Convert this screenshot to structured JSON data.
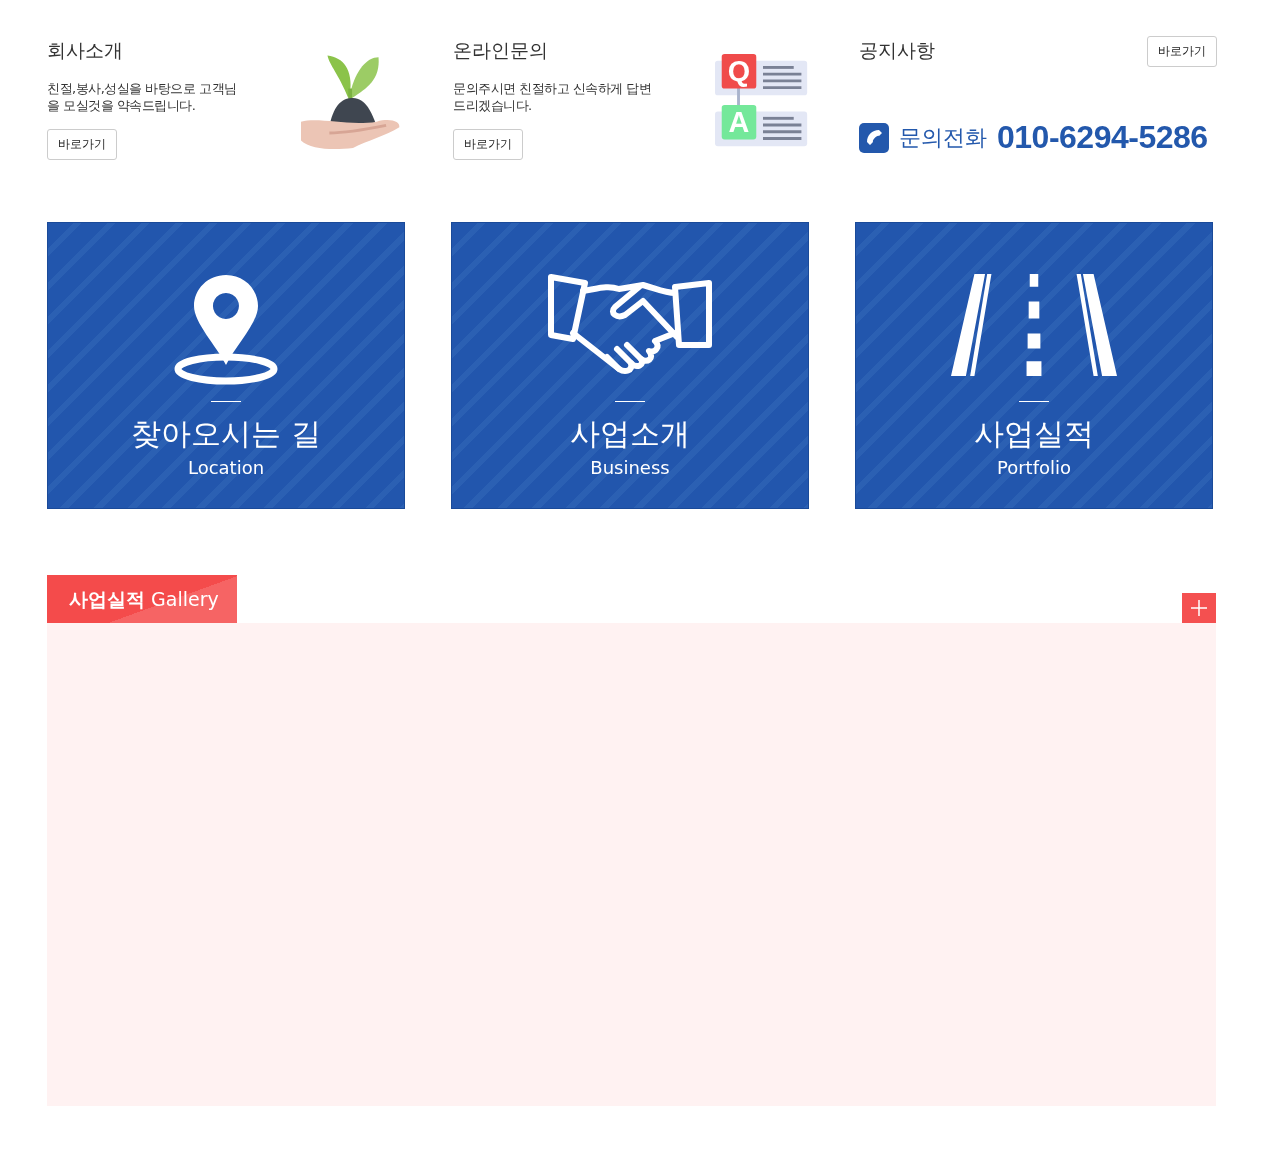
{
  "intro": [
    {
      "kind": "plant",
      "title": "회사소개",
      "description": "친절,봉사,성실을 바탕으로 고객님을 모실것을 약속드립니다.",
      "button": "바로가기"
    },
    {
      "kind": "qa",
      "title": "온라인문의",
      "description": "문의주시면 친절하고 신속하게 답변드리겠습니다.",
      "button": "바로가기",
      "q_letter": "Q",
      "a_letter": "A"
    }
  ],
  "notice": {
    "title": "공지사항",
    "button": "바로가기",
    "phone_label": "문의전화",
    "phone_number": "010-6294-5286"
  },
  "cards": [
    {
      "kind": "pin",
      "title": "찾아오시는 길",
      "subtitle": "Location"
    },
    {
      "kind": "handshake",
      "title": "사업소개",
      "subtitle": "Business"
    },
    {
      "kind": "road",
      "title": "사업실적",
      "subtitle": "Portfolio"
    }
  ],
  "gallery": {
    "tab": "**사업실적** Gallery"
  }
}
